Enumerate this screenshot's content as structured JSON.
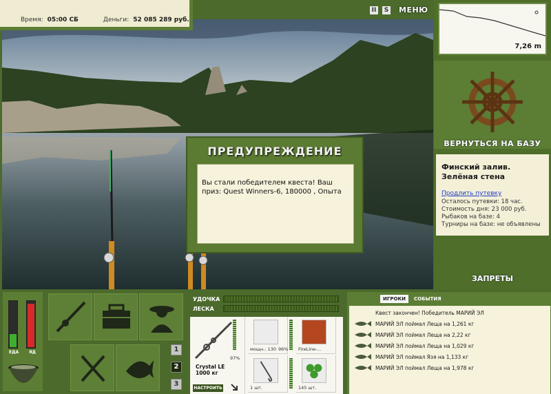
{
  "topbar": {
    "time_label": "Время:",
    "time_value": "05:00 СБ",
    "money_label": "Деньги:",
    "money_value": "52 085 289 руб."
  },
  "top_icons": {
    "pause": "II",
    "sound": "S",
    "menu": "МЕНЮ"
  },
  "depth": {
    "value": "7,26 m"
  },
  "right_panel": {
    "back_label": "ВЕРНУТЬСЯ НА БАЗУ",
    "location": "Финский залив. Зелёная стена",
    "extend_link": "Продлить путевку",
    "lines": [
      "Осталось путевки: 18 час.",
      "Стоимость дня: 23 000 руб.",
      "Рыбаков на базе: 4",
      "Турниры на базе: не объявлены"
    ],
    "bans_label": "ЗАПРЕТЫ"
  },
  "dialog": {
    "title": "ПРЕДУПРЕЖДЕНИЕ",
    "text": "Вы стали победителем квеста! Ваш приз: Quest Winners-6, 180000 , Опыта"
  },
  "meters": {
    "food_label": "ЕДА",
    "poison_label": "ЯД",
    "food_level": 0.28,
    "poison_level": 0.92
  },
  "slots": {
    "numbers": [
      "1",
      "2",
      "3"
    ],
    "active": 1
  },
  "tackle": {
    "rod_label": "УДОЧКА",
    "line_label": "ЛЕСКА",
    "rod_name": "Crystal LE",
    "rod_weight": "1000 кг",
    "rod_pct": "97%",
    "set_button": "НАСТРОИТЬ",
    "reel_caption": "мощн.: 130",
    "reel_pct": "96%",
    "line_caption": "FireLine-...",
    "hook_caption": "1 шт.",
    "bait_caption": "145 шт."
  },
  "chat": {
    "tabs": [
      "ИГРОКИ",
      "СОБЫТИЯ"
    ],
    "messages": [
      "Квест закончен! Победитель МАРИЙ ЭЛ",
      "МАРИЙ ЭЛ поймал Леща на 1,261 кг",
      "МАРИЙ ЭЛ поймал Леща на 2,22 кг",
      "МАРИЙ ЭЛ поймал Леща на 1,029 кг",
      "МАРИЙ ЭЛ поймал Язя на 1,133 кг",
      "МАРИЙ ЭЛ поймал Леща на 1,978 кг"
    ]
  }
}
